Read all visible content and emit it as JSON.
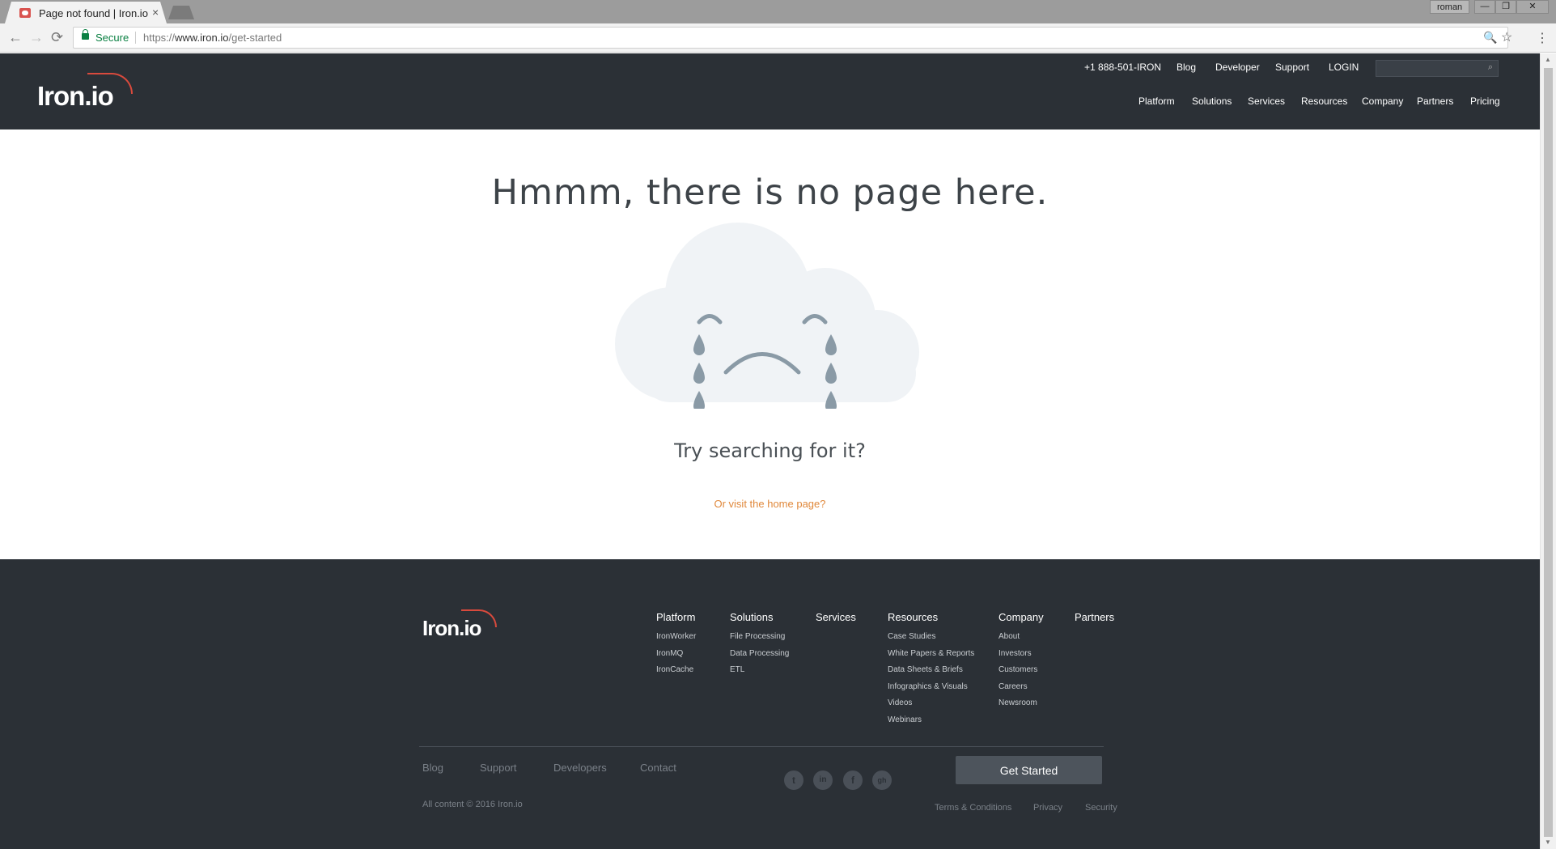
{
  "browser": {
    "tab_title": "Page not found | Iron.io",
    "tab_close": "×",
    "user": "roman",
    "win_min": "—",
    "win_restore": "❐",
    "win_close": "✕",
    "secure_label": "Secure",
    "url_prefix": "https://",
    "url_host": "www.iron.io",
    "url_path": "/get-started",
    "back_icon": "←",
    "forward_icon": "→",
    "reload_icon": "⟳",
    "zoom_icon": "🔍",
    "star_icon": "☆",
    "menu_icon": "⋮"
  },
  "header": {
    "logo": "Iron.io",
    "phone": "+1 888-501-IRON",
    "utility_links": [
      "Blog",
      "Developer",
      "Support",
      "LOGIN"
    ],
    "search_placeholder": "",
    "search_icon": "⌕",
    "nav": [
      "Platform",
      "Solutions",
      "Services",
      "Resources",
      "Company",
      "Partners",
      "Pricing"
    ]
  },
  "main": {
    "headline": "Hmmm, there is no page here.",
    "try_text": "Try searching for it?",
    "home_link": "Or visit the home page?"
  },
  "footer": {
    "logo": "Iron.io",
    "columns": [
      {
        "title": "Platform",
        "links": [
          "IronWorker",
          "IronMQ",
          "IronCache"
        ]
      },
      {
        "title": "Solutions",
        "links": [
          "File Processing",
          "Data Processing",
          "ETL"
        ]
      },
      {
        "title": "Services",
        "links": []
      },
      {
        "title": "Resources",
        "links": [
          "Case Studies",
          "White Papers & Reports",
          "Data Sheets & Briefs",
          "Infographics & Visuals",
          "Videos",
          "Webinars"
        ]
      },
      {
        "title": "Company",
        "links": [
          "About",
          "Investors",
          "Customers",
          "Careers",
          "Newsroom"
        ]
      },
      {
        "title": "Partners",
        "links": []
      }
    ],
    "bottom_links": [
      "Blog",
      "Support",
      "Developers",
      "Contact"
    ],
    "social": [
      {
        "name": "twitter",
        "glyph": "t"
      },
      {
        "name": "linkedin",
        "glyph": "in"
      },
      {
        "name": "facebook",
        "glyph": "f"
      },
      {
        "name": "github",
        "glyph": "gh"
      }
    ],
    "cta": "Get Started",
    "copyright": "All content © 2016 Iron.io",
    "legal": [
      "Terms & Conditions",
      "Privacy",
      "Security"
    ]
  },
  "colors": {
    "header_bg": "#2b3036",
    "accent_orange": "#e0883b",
    "logo_red": "#d94a3d",
    "cloud_fill": "#f0f3f6",
    "tear_color": "#8a9aa6"
  }
}
